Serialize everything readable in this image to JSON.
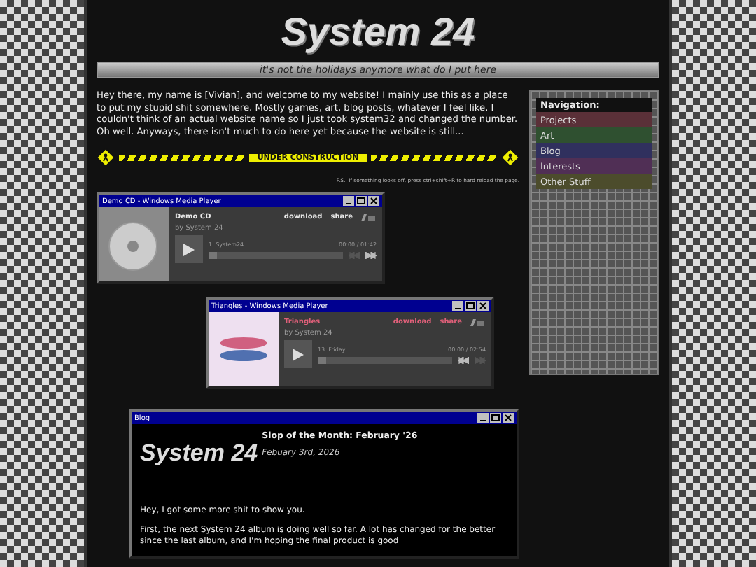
{
  "header": {
    "logo": "System 24",
    "tagline": "it's not the holidays anymore what do I put here"
  },
  "intro": "Hey there, my name is [Vivian], and welcome to my website! I mainly use this as a place to put my stupid shit somewhere. Mostly games, art, blog posts, whatever I feel like. I couldn't think of an actual website name so I just took system32 and changed the number. Oh well. Anyways, there isn't much to do here yet because the website is still...",
  "construction": {
    "label": "UNDER CONSTRUCTION"
  },
  "ps": "P.S.: If something looks off, press ctrl+shift+R to hard reload the page.",
  "navigation": {
    "title": "Navigation:",
    "items": [
      {
        "label": "Projects",
        "color": "#5a3038"
      },
      {
        "label": "Art",
        "color": "#2f5030"
      },
      {
        "label": "Blog",
        "color": "#30305e"
      },
      {
        "label": "Interests",
        "color": "#502f55"
      },
      {
        "label": "Other Stuff",
        "color": "#4c4c2c"
      }
    ]
  },
  "players": [
    {
      "window_title": "Demo CD - Windows Media Player",
      "album": "Demo CD",
      "artist": "by System 24",
      "track": "1. System24",
      "time": "00:00 / 01:42",
      "download": "download",
      "share": "share",
      "color": "#e8e8e8",
      "kind": "cd",
      "level": 0,
      "prev_enabled": false,
      "next_enabled": true
    },
    {
      "window_title": "Triangles - Windows Media Player",
      "album": "Triangles",
      "artist": "by System 24",
      "track": "13. Friday",
      "time": "00:00 / 02:54",
      "download": "download",
      "share": "share",
      "color": "#e0607a",
      "kind": "fish",
      "level": 0,
      "prev_enabled": true,
      "next_enabled": false
    }
  ],
  "blog": {
    "window_title": "Blog",
    "logo": "System 24",
    "title": "Slop of the Month: February '26",
    "date": "Febuary 3rd, 2026",
    "paragraphs": [
      "Hey, I got some more shit to show you.",
      "First, the next System 24 album is doing well so far. A lot has changed for the better since the last album, and I'm hoping the final product is good"
    ]
  }
}
